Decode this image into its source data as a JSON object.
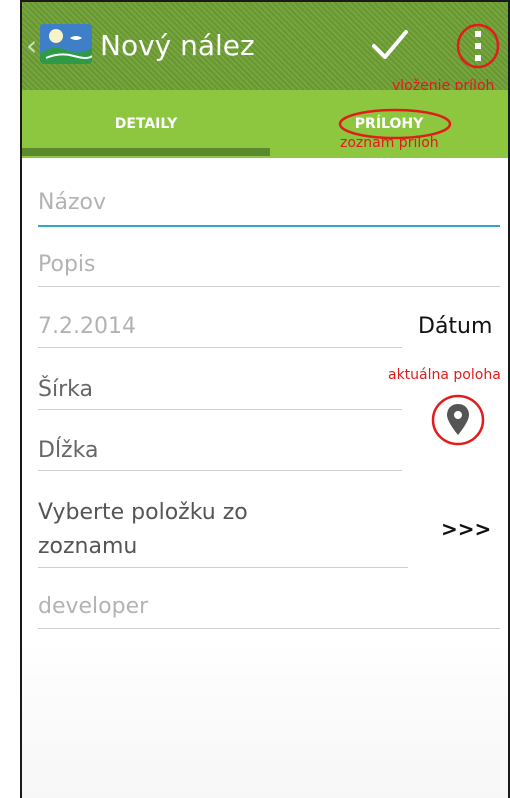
{
  "actionbar": {
    "title": "Nový nález",
    "back_icon": "chevron-left-icon",
    "logo_icon": "app-logo-icon",
    "confirm_icon": "checkmark-icon",
    "overflow_icon": "more-vertical-icon",
    "overflow_annotation": "vloženie príloh"
  },
  "tabs": {
    "items": [
      {
        "label": "DETAILY",
        "selected": true
      },
      {
        "label": "PRÍLOHY",
        "selected": false
      }
    ],
    "prilohy_annotation": "zoznam príloh"
  },
  "form": {
    "nazov_placeholder": "Názov",
    "popis_placeholder": "Popis",
    "date_value": "7.2.2014",
    "date_label": "Dátum",
    "sirka_placeholder": "Šírka",
    "dlzka_placeholder": "Dĺžka",
    "location_annotation": "aktuálna poloha",
    "location_icon": "map-pin-icon",
    "list_select_line1": "Vyberte položku zo",
    "list_select_line2": "zoznamu",
    "list_more_label": ">>>",
    "user_value": "developer"
  },
  "colors": {
    "actionbar": "#6e9f34",
    "tabbar": "#8dc63f",
    "tab_indicator": "#5b8a2d",
    "focus_underline": "#33a6c9",
    "annotation": "#e21b1b"
  }
}
